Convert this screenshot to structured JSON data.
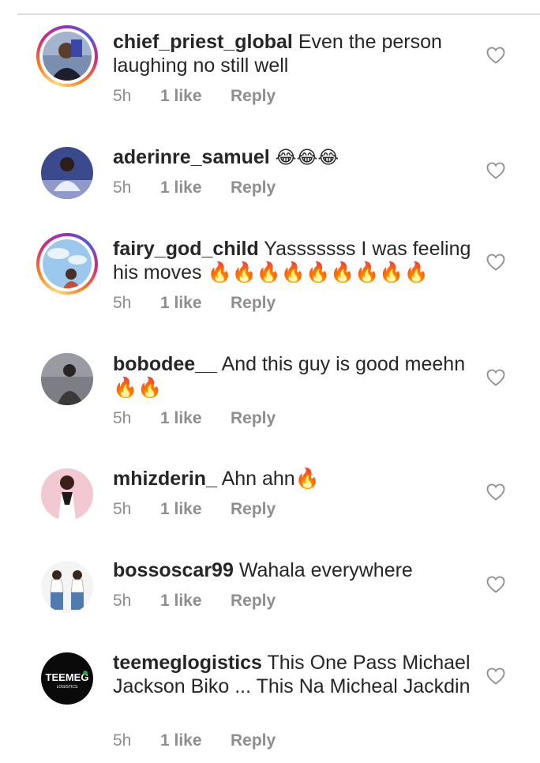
{
  "comments": [
    {
      "username": "chief_priest_global",
      "text": "Even the person laughing no still well",
      "time": "5h",
      "likes": "1 like",
      "reply": "Reply",
      "story_ring": true
    },
    {
      "username": "aderinre_samuel",
      "text": "😂😂😂",
      "time": "5h",
      "likes": "1 like",
      "reply": "Reply",
      "story_ring": false
    },
    {
      "username": "fairy_god_child",
      "text": "Yasssssss I was feeling his moves 🔥🔥🔥🔥🔥🔥🔥🔥🔥",
      "time": "5h",
      "likes": "1 like",
      "reply": "Reply",
      "story_ring": true
    },
    {
      "username": "bobodee__",
      "text": "And this guy is good meehn 🔥🔥",
      "time": "5h",
      "likes": "1 like",
      "reply": "Reply",
      "story_ring": false
    },
    {
      "username": "mhizderin_",
      "text": "Ahn ahn🔥",
      "time": "5h",
      "likes": "1 like",
      "reply": "Reply",
      "story_ring": false
    },
    {
      "username": "bossoscar99",
      "text": "Wahala everywhere",
      "time": "5h",
      "likes": "1 like",
      "reply": "Reply",
      "story_ring": false
    },
    {
      "username": "teemeglogistics",
      "text": "This One Pass Michael Jackson Biko ... This Na Micheal Jackdin",
      "time": "5h",
      "likes": "1 like",
      "reply": "Reply",
      "story_ring": false,
      "avatar_logo": "TEEMEG",
      "avatar_logo_sub": "LOGISTICS"
    }
  ],
  "icons": {
    "like": "heart-outline-icon"
  },
  "colors": {
    "text": "#262626",
    "meta": "#8e8e8e",
    "divider": "#dbdbdb"
  }
}
